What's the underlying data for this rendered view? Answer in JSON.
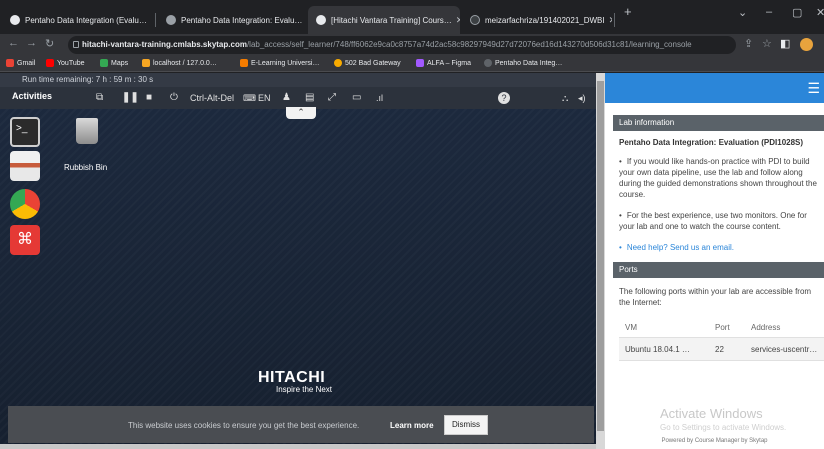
{
  "browser": {
    "tabs": [
      {
        "title": "Pentaho Data Integration (Evalu…",
        "icon": "github-icon"
      },
      {
        "title": "Pentaho Data Integration: Evalu…",
        "icon": "globe-icon"
      },
      {
        "title": "[Hitachi Vantara Training] Cours…",
        "icon": "globe-icon"
      },
      {
        "title": "meizarfachriza/191402021_DWBI",
        "icon": "github-icon"
      }
    ],
    "new_tab": "+",
    "url_host": "hitachi-vantara-training.cmlabs.skytap.com",
    "url_path": "/lab_access/self_learner/748/ff6062e9ca0c8757a74d2ac58c98297949d27d72076ed16d143270d506d31c81/learning_console",
    "bookmarks": [
      "Gmail",
      "YouTube",
      "Maps",
      "localhost / 127.0.0…",
      "E-Learning Universi…",
      "502 Bad Gateway",
      "ALFA – Figma",
      "Pentaho Data Integ…"
    ]
  },
  "lab": {
    "time_remaining": "Run time remaining: 7 h : 59 m : 30 s",
    "activities": "Activities",
    "ctrl_alt_del": "Ctrl-Alt-Del",
    "keyboard_lang": "EN",
    "rubbish_bin": "Rubbish Bin",
    "logo_line1": "HITACHI",
    "logo_line2": "Inspire the Next",
    "cookie_text": "This website uses cookies to ensure you get the best experience.",
    "learn_more": "Learn more",
    "dismiss": "Dismiss"
  },
  "panel": {
    "lab_info_header": "Lab information",
    "course_title": "Pentaho Data Integration: Evaluation (PDI1028S)",
    "bullet1": "If you would like hands-on practice with PDI to build your own data pipeline, use the lab and follow along during the guided demonstrations shown throughout the course.",
    "bullet2": "For the best experience, use two monitors. One for your lab and one to watch the course content.",
    "help_link": "Need help? Send us an email.",
    "ports_header": "Ports",
    "ports_text": "The following ports within your lab are accessible from the Internet:",
    "table": {
      "headers": [
        "VM",
        "Port",
        "Address"
      ],
      "rows": [
        [
          "Ubuntu 18.04.1 …",
          "22",
          "services-uscentr…"
        ]
      ]
    },
    "activate_title": "Activate Windows",
    "activate_sub": "Go to Settings to activate Windows.",
    "powered_by": "Powered by Course Manager by Skytap"
  },
  "colors": {
    "accent": "#2b86d9",
    "section_header": "#5a6269"
  }
}
